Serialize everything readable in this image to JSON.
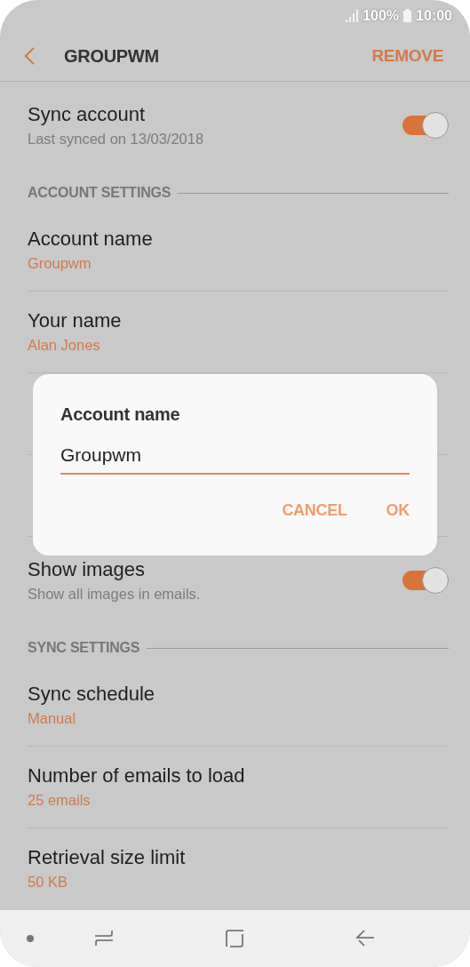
{
  "status_bar": {
    "battery": "100%",
    "time": "10:00"
  },
  "header": {
    "title": "GROUPWM",
    "action": "REMOVE"
  },
  "items": [
    {
      "kind": "switch",
      "title": "Sync account",
      "subtitle": "Last synced on 13/03/2018",
      "on": true
    },
    {
      "kind": "section",
      "title": "ACCOUNT SETTINGS"
    },
    {
      "kind": "value",
      "title": "Account name",
      "subtitle": "Groupwm"
    },
    {
      "kind": "value",
      "title": "Your name",
      "subtitle": "Alan Jones"
    },
    {
      "kind": "covered"
    },
    {
      "kind": "covered"
    },
    {
      "kind": "switch",
      "title": "Show images",
      "subtitle": "Show all images in emails.",
      "on": true
    },
    {
      "kind": "section",
      "title": "SYNC SETTINGS"
    },
    {
      "kind": "value",
      "title": "Sync schedule",
      "subtitle": "Manual"
    },
    {
      "kind": "value",
      "title": "Number of emails to load",
      "subtitle": "25 emails"
    },
    {
      "kind": "value",
      "title": "Retrieval size limit",
      "subtitle": "50 KB"
    }
  ],
  "dialog": {
    "title": "Account name",
    "value": "Groupwm",
    "buttons": [
      "CANCEL",
      "OK"
    ]
  }
}
